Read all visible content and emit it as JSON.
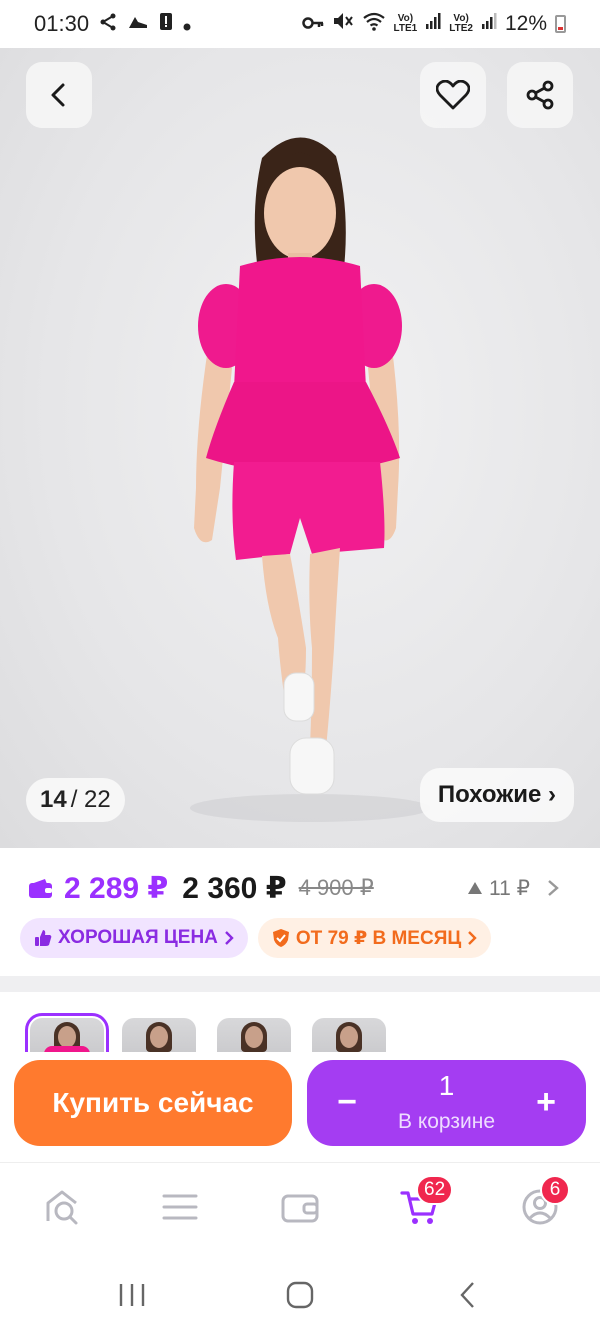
{
  "status_bar": {
    "time": "01:30",
    "lte1": "LTE1",
    "lte2": "LTE2",
    "battery": "12%"
  },
  "gallery": {
    "current": "14",
    "total": "22",
    "similar_label": "Похожие ›"
  },
  "price": {
    "wallet_price": "2 289 ₽",
    "price": "2 360 ₽",
    "old_price": "4 900 ₽",
    "delta": "11 ₽"
  },
  "chips": {
    "good_price": "ХОРОШАЯ ЦЕНА",
    "installment": "ОТ 79 ₽ В МЕСЯЦ"
  },
  "actions": {
    "buy_now": "Купить сейчас",
    "cart_qty": "1",
    "cart_label": "В корзине",
    "minus": "−",
    "plus": "+"
  },
  "bottom_nav": {
    "cart_badge": "62",
    "profile_badge": "6"
  },
  "colors": {
    "accent_purple": "#9b30ff",
    "buy_orange": "#ff7a2e",
    "cart_purple": "#a43df2",
    "badge_red": "#f0274e",
    "dress_pink": "#f0178c"
  }
}
